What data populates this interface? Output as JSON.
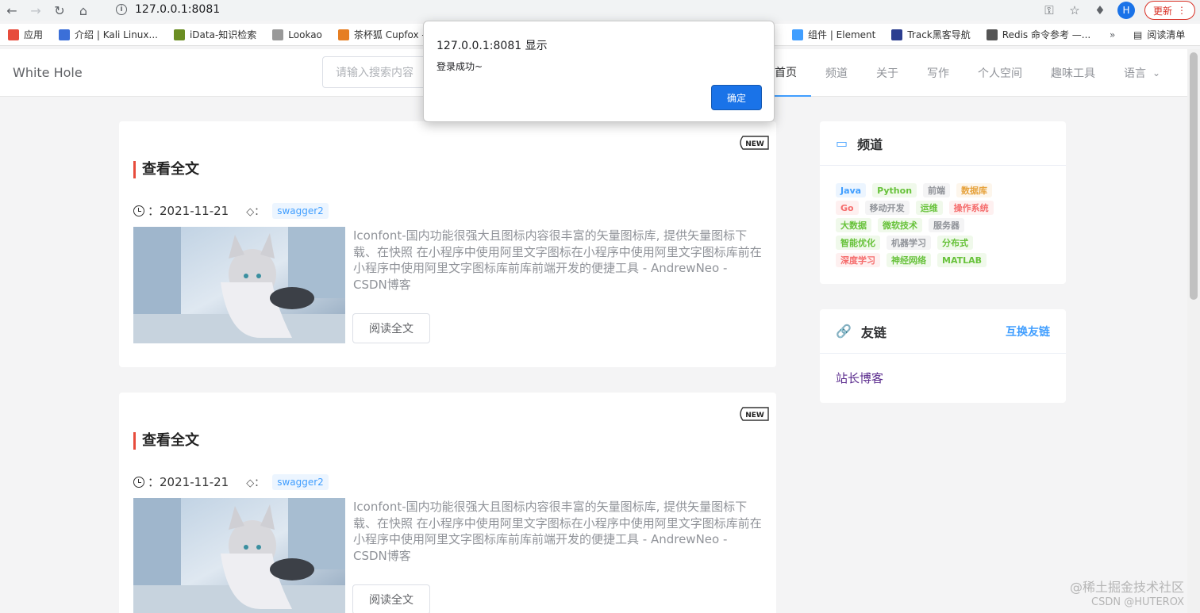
{
  "browser": {
    "url": "127.0.0.1:8081",
    "update_label": "更新",
    "avatar_letter": "H",
    "bookmarks": [
      {
        "label": "应用",
        "color": "#e74c3c"
      },
      {
        "label": "介绍 | Kali Linux...",
        "color": "#3b6fd8"
      },
      {
        "label": "iData-知识检索",
        "color": "#6b8e23"
      },
      {
        "label": "Lookao",
        "color": "#999999"
      },
      {
        "label": "茶杯狐 Cupfox -...",
        "color": "#e67e22"
      }
    ],
    "bookmarks_right": [
      {
        "label": "组件 | Element",
        "color": "#409eff"
      },
      {
        "label": "Track黑客导航",
        "color": "#2c3e90"
      },
      {
        "label": "Redis 命令参考 —...",
        "color": "#555555"
      }
    ],
    "reading_list": "阅读清单"
  },
  "header": {
    "logo": "White Hole",
    "search_placeholder": "请输入搜索内容",
    "nav": [
      "首页",
      "频道",
      "关于",
      "写作",
      "个人空间",
      "趣味工具",
      "语言"
    ]
  },
  "articles": [
    {
      "title": "查看全文",
      "date": "2021-11-21",
      "tag": "swagger2",
      "excerpt": "Iconfont-国内功能很强大且图标内容很丰富的矢量图标库, 提供矢量图标下载、在快照 在小程序中使用阿里文字图标在小程序中使用阿里文字图标库前在小程序中使用阿里文字图标库前库前端开发的便捷工具 - AndrewNeo - CSDN博客",
      "read_label": "阅读全文"
    },
    {
      "title": "查看全文",
      "date": "2021-11-21",
      "tag": "swagger2",
      "excerpt": "Iconfont-国内功能很强大且图标内容很丰富的矢量图标库, 提供矢量图标下载、在快照 在小程序中使用阿里文字图标在小程序中使用阿里文字图标库前在小程序中使用阿里文字图标库前库前端开发的便捷工具 - AndrewNeo - CSDN博客",
      "read_label": "阅读全文"
    }
  ],
  "sidebar": {
    "channels_title": "频道",
    "channels": [
      {
        "label": "Java",
        "fg": "#409eff",
        "bg": "#ecf5ff"
      },
      {
        "label": "Python",
        "fg": "#67c23a",
        "bg": "#f0f9eb"
      },
      {
        "label": "前端",
        "fg": "#909399",
        "bg": "#f4f4f5"
      },
      {
        "label": "数据库",
        "fg": "#e6a23c",
        "bg": "#fdf6ec"
      },
      {
        "label": "Go",
        "fg": "#f56c6c",
        "bg": "#fef0f0"
      },
      {
        "label": "移动开发",
        "fg": "#909399",
        "bg": "#f4f4f5"
      },
      {
        "label": "运维",
        "fg": "#67c23a",
        "bg": "#f0f9eb"
      },
      {
        "label": "操作系统",
        "fg": "#f56c6c",
        "bg": "#fef0f0"
      },
      {
        "label": "大数据",
        "fg": "#67c23a",
        "bg": "#f0f9eb"
      },
      {
        "label": "微软技术",
        "fg": "#67c23a",
        "bg": "#f0f9eb"
      },
      {
        "label": "服务器",
        "fg": "#909399",
        "bg": "#f4f4f5"
      },
      {
        "label": "智能优化",
        "fg": "#67c23a",
        "bg": "#f0f9eb"
      },
      {
        "label": "机器学习",
        "fg": "#909399",
        "bg": "#f4f4f5"
      },
      {
        "label": "分布式",
        "fg": "#67c23a",
        "bg": "#f0f9eb"
      },
      {
        "label": "深度学习",
        "fg": "#f56c6c",
        "bg": "#fef0f0"
      },
      {
        "label": "神经网络",
        "fg": "#67c23a",
        "bg": "#f0f9eb"
      },
      {
        "label": "MATLAB",
        "fg": "#67c23a",
        "bg": "#f0f9eb"
      }
    ],
    "links_title": "友链",
    "exchange_label": "互换友链",
    "links": [
      "站长博客"
    ]
  },
  "dialog": {
    "title": "127.0.0.1:8081 显示",
    "message": "登录成功~",
    "ok_label": "确定"
  },
  "watermark": {
    "line1": "@稀土掘金技术社区",
    "line2": "CSDN @HUTEROX"
  }
}
